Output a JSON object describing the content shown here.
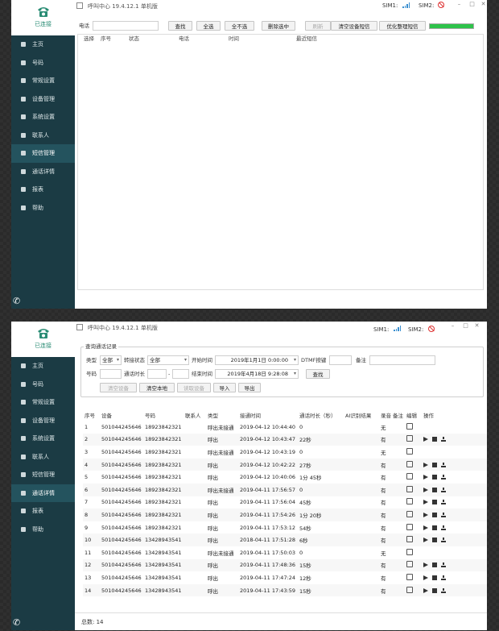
{
  "app": {
    "title": "呼叫中心 19.4.12.1 单机版",
    "connection_status": "已连接",
    "sim1_label": "SIM1:",
    "sim2_label": "SIM2:"
  },
  "nav": [
    {
      "label": "主页",
      "icon": "home-icon"
    },
    {
      "label": "号码",
      "icon": "number-icon"
    },
    {
      "label": "常规设置",
      "icon": "gear-icon"
    },
    {
      "label": "设备管理",
      "icon": "device-icon"
    },
    {
      "label": "系统设置",
      "icon": "system-icon"
    },
    {
      "label": "联系人",
      "icon": "contacts-icon"
    },
    {
      "label": "短信管理",
      "icon": "sms-icon"
    },
    {
      "label": "通话详情",
      "icon": "call-detail-icon"
    },
    {
      "label": "报表",
      "icon": "report-icon"
    },
    {
      "label": "帮助",
      "icon": "help-icon"
    }
  ],
  "sms_window": {
    "active_nav": "短信管理",
    "phone_label": "电话",
    "phone_value": "",
    "buttons": {
      "search": "查找",
      "select_all": "全选",
      "select_none": "全不选",
      "delete_selected": "删除选中",
      "refresh": "刷新",
      "clear_device_sms": "清空设备短信",
      "optimize_sms": "优化整理短信"
    },
    "progress_fraction": 1.0,
    "columns": [
      "选择",
      "序号",
      "状态",
      "电话",
      "时间",
      "最近短信"
    ]
  },
  "call_window": {
    "active_nav": "通话详情",
    "group_title": "查询通话记录",
    "filters": {
      "type_label": "类型",
      "type_value": "全部",
      "forward_label": "转接状态",
      "forward_value": "全部",
      "start_time_label": "开始时间",
      "start_time_value": "2019年1月1日 0:00:00",
      "dtmf_label": "DTMF按键",
      "dtmf_value": "",
      "note_label": "备注",
      "note_value": "",
      "number_label": "号码",
      "number_value": "",
      "duration_label": "通话时长",
      "duration_from": "",
      "duration_sep": "-",
      "duration_to": "",
      "end_time_label": "结束时间",
      "end_time_value": "2019年4月18日 9:28:08"
    },
    "buttons": {
      "search": "查找",
      "clear_device": "清空设备",
      "clear_local": "清空本地",
      "read_device": "读取设备",
      "import": "导入",
      "export": "导出"
    },
    "columns": [
      "序号",
      "设备",
      "号码",
      "联系人",
      "类型",
      "接通时间",
      "通话时长（秒）",
      "AI识别结果",
      "录音",
      "备注",
      "编辑",
      "操作"
    ],
    "rows": [
      {
        "no": "1",
        "device": "501044245646",
        "number": "18923842321",
        "contact": "",
        "type": "呼出未接通",
        "time": "2019-04-12 10:44:40",
        "duration": "0",
        "ai": "",
        "recording": "无",
        "note": "",
        "ops": false
      },
      {
        "no": "2",
        "device": "501044245646",
        "number": "18923842321",
        "contact": "",
        "type": "呼出",
        "time": "2019-04-12 10:43:47",
        "duration": "22秒",
        "ai": "",
        "recording": "有",
        "note": "",
        "ops": true
      },
      {
        "no": "3",
        "device": "501044245646",
        "number": "18923842321",
        "contact": "",
        "type": "呼出未接通",
        "time": "2019-04-12 10:43:19",
        "duration": "0",
        "ai": "",
        "recording": "无",
        "note": "",
        "ops": false
      },
      {
        "no": "4",
        "device": "501044245646",
        "number": "18923842321",
        "contact": "",
        "type": "呼出",
        "time": "2019-04-12 10:42:22",
        "duration": "27秒",
        "ai": "",
        "recording": "有",
        "note": "",
        "ops": true
      },
      {
        "no": "5",
        "device": "501044245646",
        "number": "18923842321",
        "contact": "",
        "type": "呼出",
        "time": "2019-04-12 10:40:06",
        "duration": "1分 45秒",
        "ai": "",
        "recording": "有",
        "note": "",
        "ops": true
      },
      {
        "no": "6",
        "device": "501044245646",
        "number": "18923842321",
        "contact": "",
        "type": "呼出未接通",
        "time": "2019-04-11 17:56:57",
        "duration": "0",
        "ai": "",
        "recording": "有",
        "note": "",
        "ops": true
      },
      {
        "no": "7",
        "device": "501044245646",
        "number": "18923842321",
        "contact": "",
        "type": "呼出",
        "time": "2019-04-11 17:56:04",
        "duration": "45秒",
        "ai": "",
        "recording": "有",
        "note": "",
        "ops": true
      },
      {
        "no": "8",
        "device": "501044245646",
        "number": "18923842321",
        "contact": "",
        "type": "呼出",
        "time": "2019-04-11 17:54:26",
        "duration": "1分 20秒",
        "ai": "",
        "recording": "有",
        "note": "",
        "ops": true
      },
      {
        "no": "9",
        "device": "501044245646",
        "number": "18923842321",
        "contact": "",
        "type": "呼出",
        "time": "2019-04-11 17:53:12",
        "duration": "54秒",
        "ai": "",
        "recording": "有",
        "note": "",
        "ops": true
      },
      {
        "no": "10",
        "device": "501044245646",
        "number": "13428943541",
        "contact": "",
        "type": "呼出",
        "time": "2018-04-11 17:51:28",
        "duration": "6秒",
        "ai": "",
        "recording": "有",
        "note": "",
        "ops": true
      },
      {
        "no": "11",
        "device": "501044245646",
        "number": "13428943541",
        "contact": "",
        "type": "呼出未接通",
        "time": "2019-04-11 17:50:03",
        "duration": "0",
        "ai": "",
        "recording": "无",
        "note": "",
        "ops": false
      },
      {
        "no": "12",
        "device": "501044245646",
        "number": "13428943541",
        "contact": "",
        "type": "呼出",
        "time": "2019-04-11 17:48:36",
        "duration": "15秒",
        "ai": "",
        "recording": "有",
        "note": "",
        "ops": true
      },
      {
        "no": "13",
        "device": "501044245646",
        "number": "13428943541",
        "contact": "",
        "type": "呼出",
        "time": "2019-04-11 17:47:24",
        "duration": "12秒",
        "ai": "",
        "recording": "有",
        "note": "",
        "ops": true
      },
      {
        "no": "14",
        "device": "501044245646",
        "number": "13428943541",
        "contact": "",
        "type": "呼出",
        "time": "2019-04-11 17:43:59",
        "duration": "15秒",
        "ai": "",
        "recording": "有",
        "note": "",
        "ops": true
      }
    ],
    "total_label": "总数:",
    "total_value": "14"
  }
}
